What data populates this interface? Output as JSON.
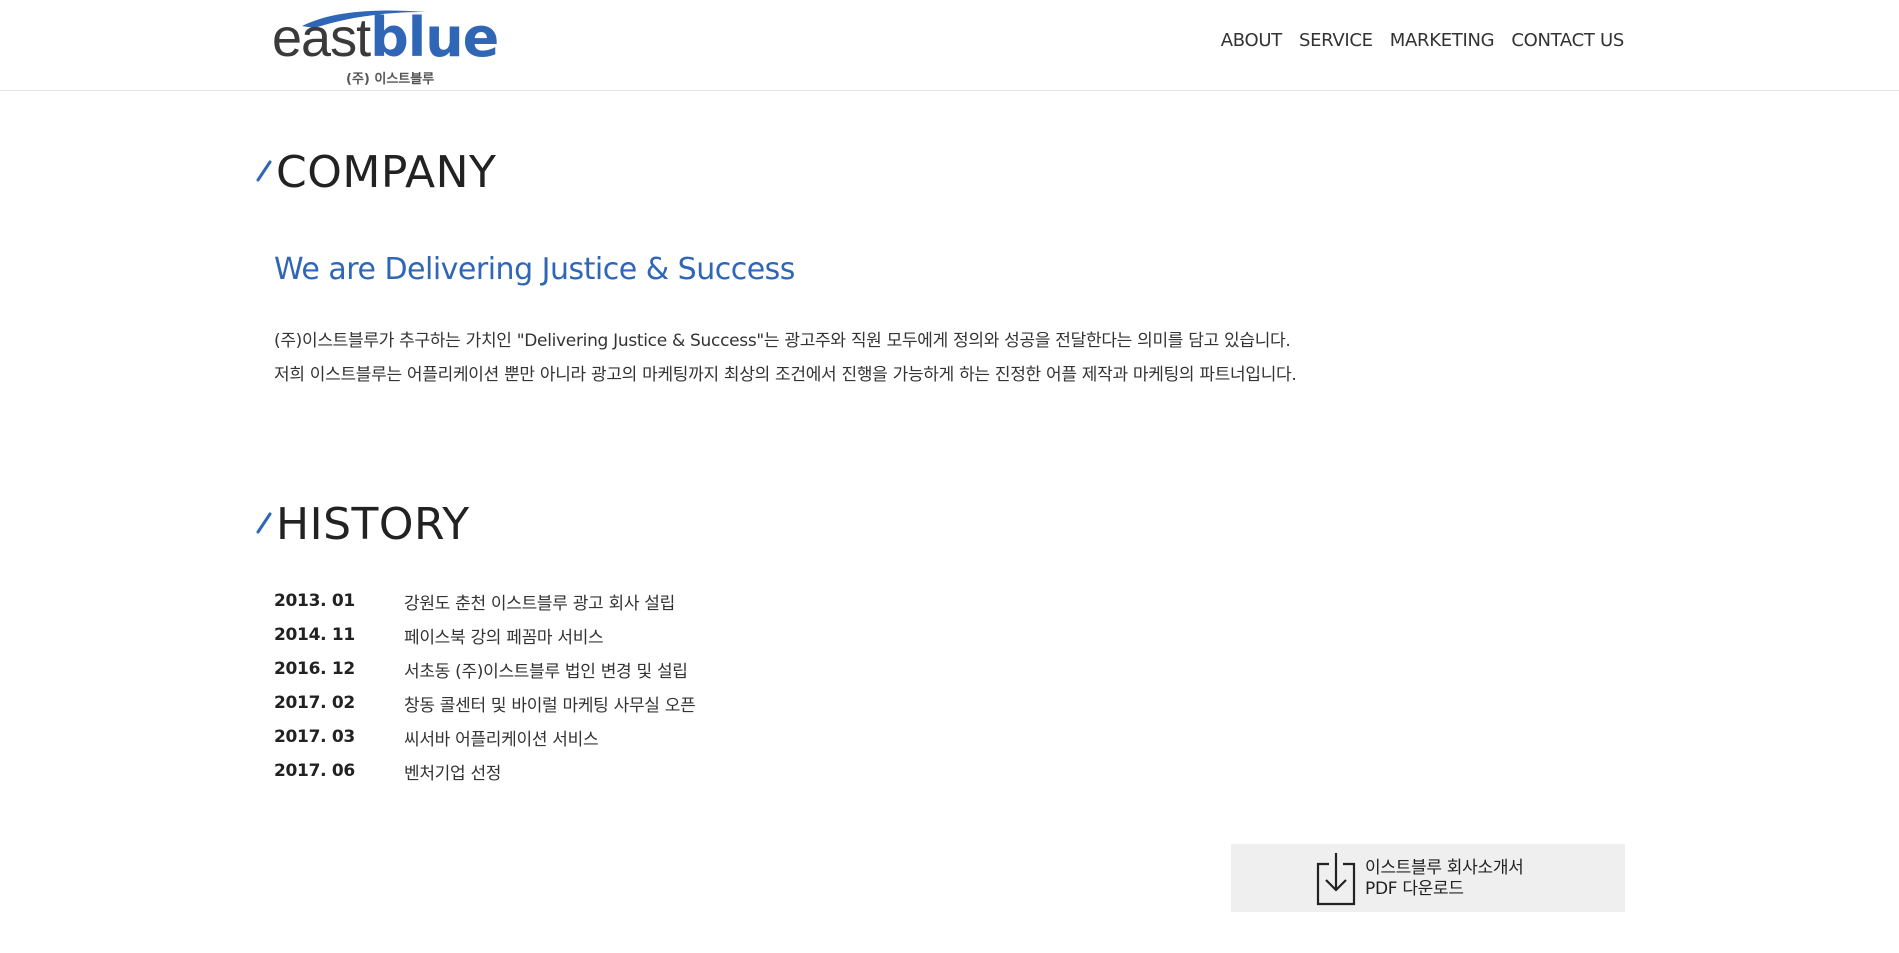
{
  "colors": {
    "brand_blue": "#2f66b6",
    "text_dark": "#222222",
    "button_bg": "#efefef",
    "header_border": "#e3e3e3"
  },
  "header": {
    "logo": {
      "word_east": "east",
      "word_blue": "blue",
      "subtitle": "(주) 이스트블루"
    },
    "nav": [
      {
        "label": "ABOUT"
      },
      {
        "label": "SERVICE"
      },
      {
        "label": "MARKETING"
      },
      {
        "label": "CONTACT US"
      }
    ]
  },
  "company": {
    "title": "COMPANY",
    "tagline": "We are Delivering Justice & Success",
    "paragraphs": [
      "(주)이스트블루가 추구하는 가치인 \"Delivering Justice & Success\"는 광고주와 직원 모두에게 정의와 성공을 전달한다는 의미를 담고 있습니다.",
      "저희 이스트블루는 어플리케이션 뿐만 아니라 광고의 마케팅까지 최상의 조건에서 진행을 가능하게 하는 진정한 어플 제작과 마케팅의 파트너입니다."
    ]
  },
  "history": {
    "title": "HISTORY",
    "items": [
      {
        "date": "2013. 01",
        "text": "강원도 춘천 이스트블루 광고 회사 설립"
      },
      {
        "date": "2014. 11",
        "text": "페이스북 강의 페꼼마 서비스"
      },
      {
        "date": "2016. 12",
        "text": "서초동 (주)이스트블루 법인 변경 및 설립"
      },
      {
        "date": "2017. 02",
        "text": "창동 콜센터 및 바이럴 마케팅 사무실 오픈"
      },
      {
        "date": "2017. 03",
        "text": "씨서바 어플리케이션 서비스"
      },
      {
        "date": "2017. 06",
        "text": "벤처기업 선정"
      }
    ]
  },
  "download": {
    "line1": "이스트블루 회사소개서",
    "line2": "PDF 다운로드",
    "icon": "download-icon"
  }
}
